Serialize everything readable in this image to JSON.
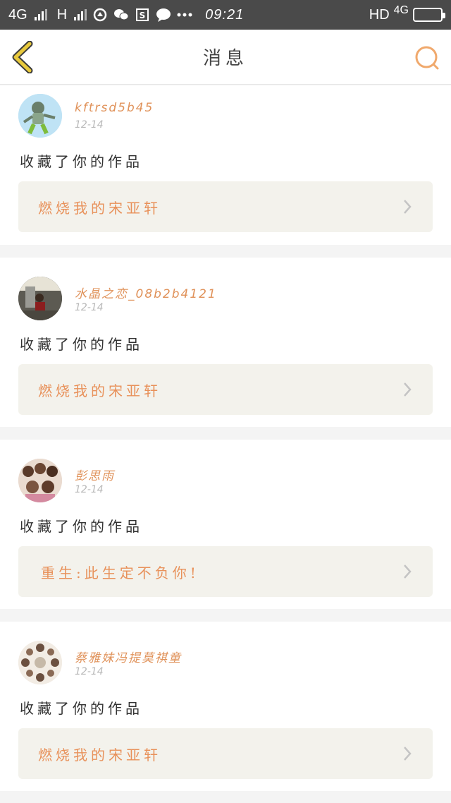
{
  "status_bar": {
    "net1": "4G",
    "net2": "H",
    "time": "09:21",
    "right_hd": "HD",
    "right_net": "4G"
  },
  "nav": {
    "title": "消息"
  },
  "messages": [
    {
      "username": "kftrsd5b45",
      "date": "12-14",
      "action": "收藏了你的作品",
      "work_title": "燃烧我的宋亚轩"
    },
    {
      "username": "水晶之恋_08b2b4121",
      "date": "12-14",
      "action": "收藏了你的作品",
      "work_title": "燃烧我的宋亚轩"
    },
    {
      "username": "彭思雨",
      "date": "12-14",
      "action": "收藏了你的作品",
      "work_title": "重生:此生定不负你!"
    },
    {
      "username": "蔡雅妹冯提莫祺童",
      "date": "12-14",
      "action": "收藏了你的作品",
      "work_title": "燃烧我的宋亚轩"
    }
  ],
  "colors": {
    "accent": "#e8915a",
    "back_icon": "#e8c93c",
    "status_bar_bg": "#4a4a4a"
  }
}
